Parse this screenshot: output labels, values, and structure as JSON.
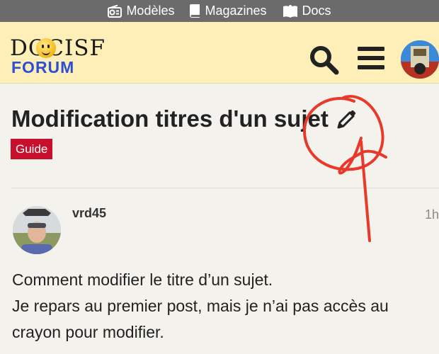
{
  "top_nav": {
    "items": [
      {
        "label": "Modèles",
        "icon": "radio-icon"
      },
      {
        "label": "Magazines",
        "icon": "book-icon"
      },
      {
        "label": "Docs",
        "icon": "open-book-icon"
      }
    ]
  },
  "header": {
    "logo_top": "DOCISF",
    "logo_bottom": "FORUM"
  },
  "topic": {
    "title": "Modification titres d'un sujet",
    "tag": "Guide"
  },
  "post": {
    "username": "vrd45",
    "time": "1h",
    "body": [
      "Comment modifier le titre d’un sujet.",
      "Je repars au premier post, mais je n’ai pas accès au",
      "crayon pour modifier."
    ]
  },
  "colors": {
    "header_bg": "#fdefb7",
    "topnav_bg": "#6b6b6b",
    "tag_bg": "#c8102e",
    "annotation": "#e8392b"
  }
}
